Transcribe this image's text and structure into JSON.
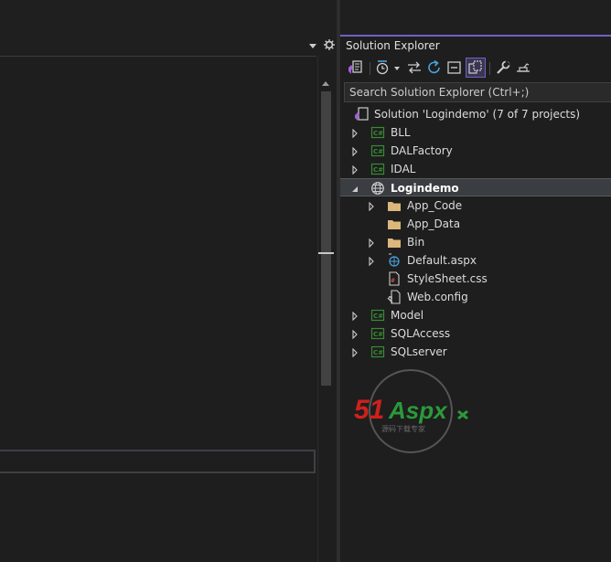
{
  "solution_explorer": {
    "title": "Solution Explorer",
    "search_placeholder": "Search Solution Explorer (Ctrl+;)",
    "solution_label": "Solution 'Logindemo' (7 of 7 projects)",
    "items": [
      {
        "label": "BLL",
        "icon": "csharp-project-icon",
        "expander": "collapsed"
      },
      {
        "label": "DALFactory",
        "icon": "csharp-project-icon",
        "expander": "collapsed"
      },
      {
        "label": "IDAL",
        "icon": "csharp-project-icon",
        "expander": "collapsed"
      },
      {
        "label": "Logindemo",
        "icon": "web-project-icon",
        "expander": "expanded",
        "selected": true
      },
      {
        "label": "App_Code",
        "icon": "folder-icon",
        "expander": "collapsed"
      },
      {
        "label": "App_Data",
        "icon": "folder-icon",
        "expander": "none"
      },
      {
        "label": "Bin",
        "icon": "folder-icon",
        "expander": "collapsed"
      },
      {
        "label": "Default.aspx",
        "icon": "aspx-file-icon",
        "expander": "collapsed"
      },
      {
        "label": "StyleSheet.css",
        "icon": "css-file-icon",
        "expander": "none"
      },
      {
        "label": "Web.config",
        "icon": "config-file-icon",
        "expander": "none"
      },
      {
        "label": "Model",
        "icon": "csharp-project-icon",
        "expander": "collapsed"
      },
      {
        "label": "SQLAccess",
        "icon": "csharp-project-icon",
        "expander": "collapsed"
      },
      {
        "label": "SQLserver",
        "icon": "csharp-project-icon",
        "expander": "collapsed"
      }
    ]
  },
  "watermark": {
    "brand_number": "51",
    "brand_text": "Aspx",
    "tagline": "源码下载专家"
  },
  "colors": {
    "accent": "#6e62c4",
    "csharp": "#388a34",
    "folder": "#dcb67a",
    "selected_row": "#3a3d41",
    "background": "#1e1e1e"
  }
}
